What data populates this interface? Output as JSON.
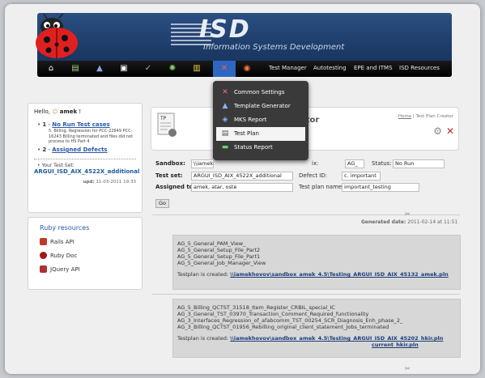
{
  "header": {
    "logo": "ISD",
    "subtitle": "Information Systems Development",
    "nav_links": [
      "Test Manager",
      "Autotesting",
      "EPE and ITMS",
      "ISD Resources"
    ],
    "nav_icons": [
      "home-icon",
      "document-icon",
      "flask-icon",
      "print-icon",
      "check-icon",
      "gear-icon",
      "chart-icon",
      "tools-icon",
      "lifebuoy-icon"
    ]
  },
  "dropdown": {
    "items": [
      "Common Settings",
      "Template Generator",
      "MKS Report",
      "Test Plan",
      "Status Report"
    ],
    "selected": "Test Plan"
  },
  "user": {
    "hello": "Hello,",
    "name": "amek",
    "suffix": "!",
    "no_run_num": "1",
    "no_run_dash": "-",
    "no_run_label": "No Run Test cases",
    "no_run_detail": "5. Billing. Regression for PCC-22649 PCC-16243 Billing terminated and files did not process to HS Part 4",
    "assigned_num": "2",
    "assigned_dash": "-",
    "assigned_label": "Assigned Defects",
    "test_set_label": "Your Test Set:",
    "test_set_value": "ARGUI_ISD_AIX_4522X_additional_",
    "upd_label": "upd:",
    "upd_value": "11-03-2011 19:33"
  },
  "ruby": {
    "title": "Ruby resources",
    "links": [
      "Rails API",
      "Ruby Doc",
      "JQuery API"
    ]
  },
  "plan": {
    "title": "Test Plan Creator",
    "title_visible": "ator",
    "breadcrumb_home": "Home",
    "breadcrumb_sep": "|",
    "breadcrumb_current": "Test Plan Creator"
  },
  "form": {
    "sandbox_label": "Sandbox:",
    "sandbox_value": "\\\\iamekh",
    "prefix_label": "ix:",
    "prefix_value": "AG_",
    "status_label": "Status:",
    "status_value": "No Run",
    "testset_label": "Test set:",
    "testset_value": "ARGUI_ISD_AIX_4522X_additional",
    "defect_label": "Defect ID:",
    "defect_value": "c. important",
    "assigned_label": "Assigned to:",
    "assigned_value": "amek, atar, oste",
    "planname_label": "Test plan name:",
    "planname_value": "important_testing",
    "go": "Go"
  },
  "results": {
    "generated_label": "Generated date:",
    "generated_value": "2011-02-14 at 11:51",
    "block1": [
      "AG_5_General_PAM_View_",
      "AG_5_General_Setup_File_Part2",
      "AG_5_General_Setup_File_Part1",
      "AG_5_General_Job_Manager_View"
    ],
    "block1_created": "Testplan is created:",
    "block1_link": "\\\\iamekhovov\\sandbox_amek_4.5\\Testing_ARGUI_ISD_AIX_45132_amek.pln",
    "block2": [
      "AG_5_Billing_QCTST_31518_Item_Register_CRBIL_special_IC",
      "AG_3_General_TST_03970_Transaction_Comment_Required_functionality",
      "AG_3_Interfaces_Regression_of_afabcomm_TST_00254_SCR_Diagnosis_Enh_phase_2_",
      "AG_3_Billing_QCTST_01956_Rebilling_original_client_statement_Jobs_terminated"
    ],
    "block2_created": "Testplan is created:",
    "block2_link1": "\\\\iamekhovov\\sandbox_amek_4.5\\Testing_ARGUI_ISD_AIX_45202_hkir.pln",
    "block2_link2": "current_hkir.pln"
  }
}
